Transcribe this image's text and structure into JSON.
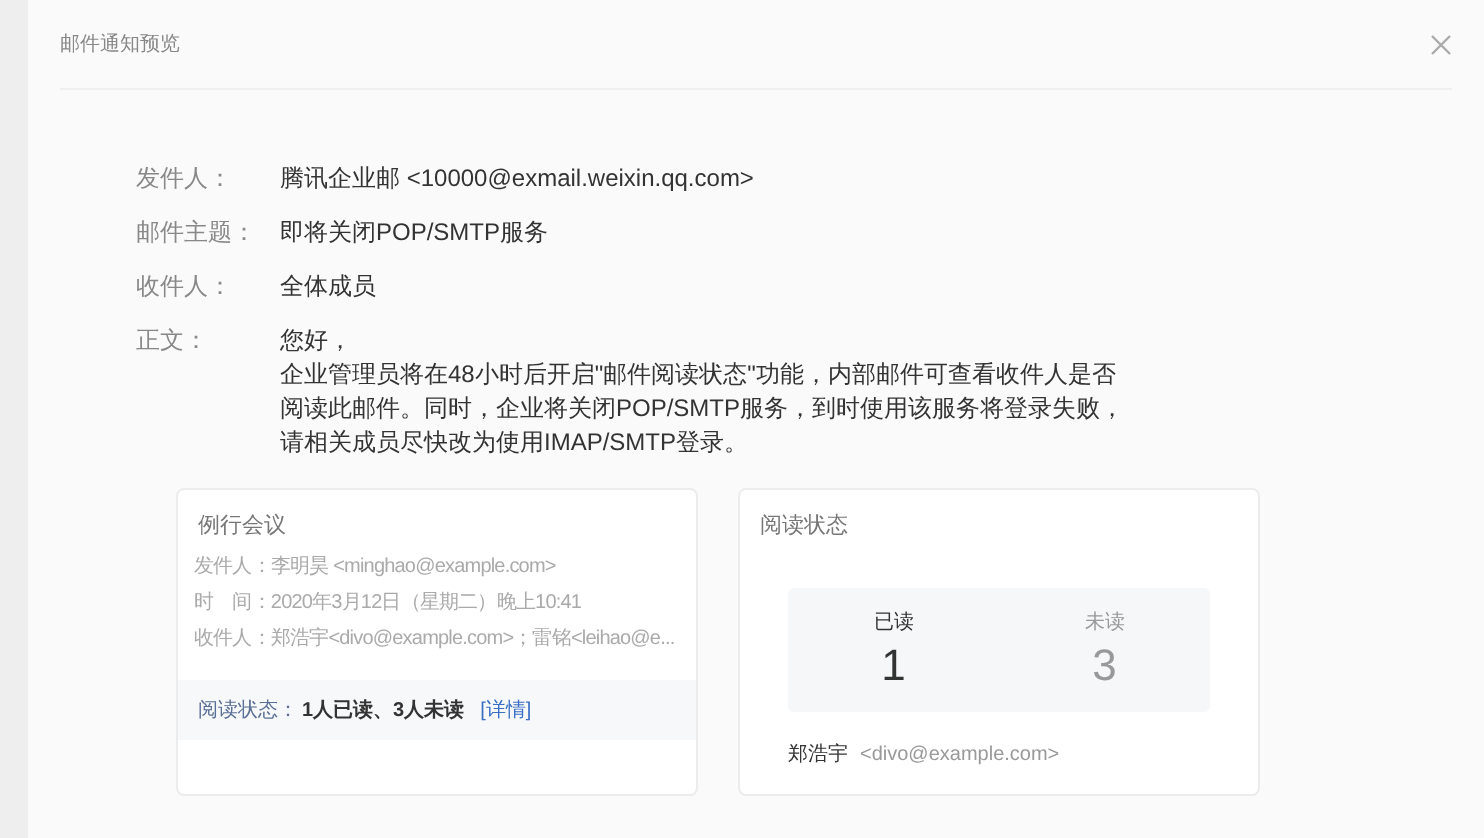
{
  "dialog": {
    "title": "邮件通知预览"
  },
  "fields": [
    {
      "label": "发件人：",
      "value": "腾讯企业邮 <10000@exmail.weixin.qq.com>"
    },
    {
      "label": "邮件主题：",
      "value": "即将关闭POP/SMTP服务"
    },
    {
      "label": "收件人：",
      "value": "全体成员"
    }
  ],
  "body": {
    "label": "正文：",
    "lines": [
      "您好，",
      "企业管理员将在48小时后开启\"邮件阅读状态\"功能，内部邮件可查看收件人是否",
      "阅读此邮件。同时，企业将关闭POP/SMTP服务，到时使用该服务将登录失败，",
      "请相关成员尽快改为使用IMAP/SMTP登录。"
    ]
  },
  "mail_card": {
    "title": "例行会议",
    "meta": [
      {
        "label": "发件人：",
        "value": "李明昊 <minghao@example.com>"
      },
      {
        "label": "时　间：",
        "value": "2020年3月12日（星期二）晚上10:41"
      },
      {
        "label": "收件人：",
        "value": "郑浩宇<divo@example.com>；雷铭<leihao@e..."
      }
    ],
    "status_label": "阅读状态：",
    "status_value": "1人已读、3人未读",
    "details_link": "[详情]"
  },
  "status_card": {
    "title": "阅读状态",
    "stats": [
      {
        "label": "已读",
        "count": "1",
        "selected": true
      },
      {
        "label": "未读",
        "count": "3",
        "selected": false
      }
    ],
    "readers": [
      {
        "name": "郑浩宇",
        "email": "<divo@example.com>"
      }
    ]
  }
}
